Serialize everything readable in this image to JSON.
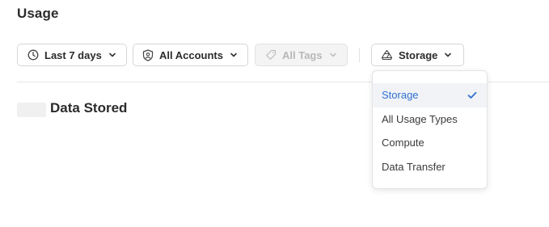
{
  "page": {
    "title": "Usage"
  },
  "filters": {
    "date_range": {
      "label": "Last 7 days",
      "icon": "clock-icon"
    },
    "accounts": {
      "label": "All Accounts",
      "icon": "account-shield-icon"
    },
    "tags": {
      "label": "All Tags",
      "icon": "tag-icon",
      "disabled": true
    },
    "usage_type": {
      "label": "Storage",
      "icon": "storage-stack-icon",
      "expanded": true
    }
  },
  "dropdown": {
    "items": [
      {
        "label": "Storage",
        "selected": true
      },
      {
        "label": "All Usage Types",
        "selected": false
      },
      {
        "label": "Compute",
        "selected": false
      },
      {
        "label": "Data Transfer",
        "selected": false
      }
    ]
  },
  "section": {
    "title": "Data Stored"
  },
  "colors": {
    "accent": "#2f6fd1",
    "text": "#2b2b2b",
    "disabled_text": "#b8b8b8",
    "border": "#d6d6d6",
    "selected_bg": "#f1f3f6"
  }
}
